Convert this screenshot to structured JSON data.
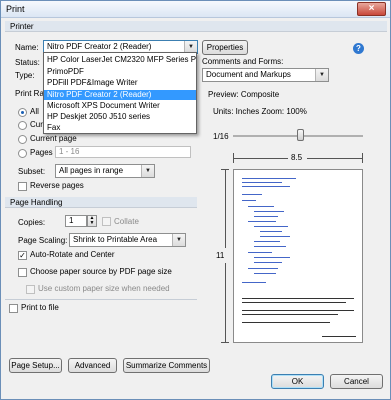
{
  "window": {
    "title": "Print",
    "close_glyph": "×"
  },
  "printer": {
    "section_label": "Printer",
    "name_label": "Name:",
    "name_value": "Nitro PDF Creator 2 (Reader)",
    "properties_label": "Properties",
    "status_label": "Status:",
    "type_label": "Type:",
    "dropdown_options": [
      "HP Color LaserJet CM2320 MFP Series PCL 6",
      "PrimoPDF",
      "PDFill PDF&Image Writer",
      "Nitro PDF Creator 2 (Reader)",
      "Microsoft XPS Document Writer",
      "HP Deskjet 2050 J510 series",
      "Fax"
    ],
    "help_glyph": "?"
  },
  "comments": {
    "label": "Comments and Forms:",
    "value": "Document and Markups"
  },
  "print_range": {
    "section_label": "Print Range",
    "all_label": "All",
    "current_view_label": "Current view",
    "current_page_label": "Current page",
    "pages_label": "Pages",
    "pages_value": "1 - 16",
    "subset_label": "Subset:",
    "subset_value": "All pages in range",
    "reverse_label": "Reverse pages"
  },
  "page_handling": {
    "section_label": "Page Handling",
    "copies_label": "Copies:",
    "copies_value": "1",
    "collate_label": "Collate",
    "scaling_label": "Page Scaling:",
    "scaling_value": "Shrink to Printable Area",
    "auto_rotate_label": "Auto-Rotate and Center",
    "paper_source_label": "Choose paper source by PDF page size",
    "custom_paper_label": "Use custom paper size when needed",
    "check_glyph": "✓"
  },
  "print_to_file_label": "Print to file",
  "preview": {
    "label": "Preview: Composite",
    "units": "Units: Inches Zoom: 100%",
    "page_fraction": "1/16",
    "width_label": "8.5",
    "height_label": "11"
  },
  "bottom": {
    "page_setup": "Page Setup...",
    "advanced": "Advanced",
    "summarize": "Summarize Comments",
    "ok": "OK",
    "cancel": "Cancel"
  }
}
